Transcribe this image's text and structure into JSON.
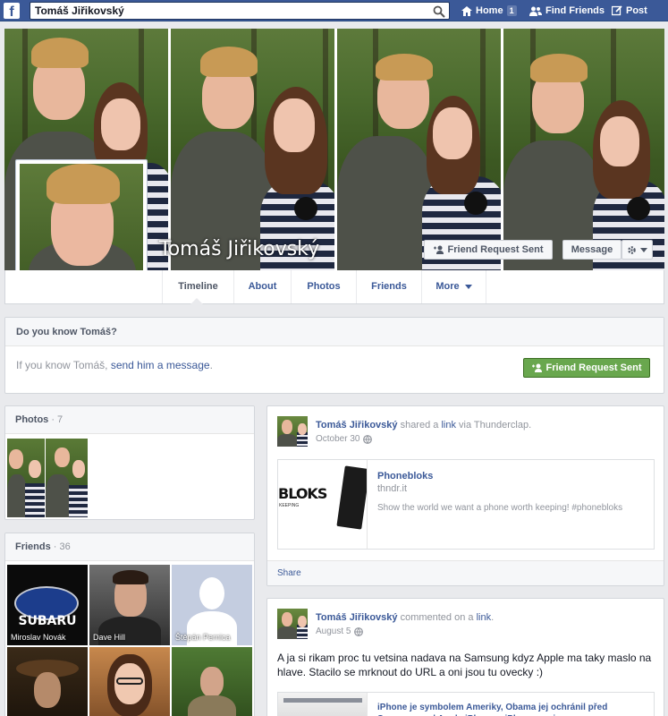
{
  "topbar": {
    "logo_icon": "facebook-f-icon",
    "search_value": "Tomáš Jiřikovský",
    "search_icon": "search-icon",
    "home_label": "Home",
    "home_badge": "1",
    "find_friends_label": "Find Friends",
    "post_label": "Post"
  },
  "profile": {
    "name": "Tomáš Jiřikovský",
    "friend_request_label": "Friend Request Sent",
    "message_label": "Message",
    "settings_icon": "gear-icon"
  },
  "tabs": [
    {
      "label": "Timeline"
    },
    {
      "label": "About"
    },
    {
      "label": "Photos"
    },
    {
      "label": "Friends"
    },
    {
      "label": "More"
    }
  ],
  "know": {
    "title": "Do you know Tomáš?",
    "message_prefix": "If you know Tomáš, ",
    "message_link": "send him a message",
    "message_suffix": ".",
    "button_label": "Friend Request Sent"
  },
  "photos_box": {
    "title": "Photos",
    "count": " · 7"
  },
  "friends_box": {
    "title": "Friends",
    "count": " · 36",
    "friends": [
      {
        "name": "Miroslav Novák"
      },
      {
        "name": "Dave Hill"
      },
      {
        "name": "Štěpán Pernica"
      }
    ],
    "subaru_logo_text": "SUBARU"
  },
  "posts": [
    {
      "author": "Tomáš Jiřikovský",
      "action_prefix": " shared a ",
      "action_link": "link",
      "action_suffix": " via Thunderclap.",
      "date": "October 30",
      "link_title": "Phonebloks",
      "link_domain": "thndr.it",
      "link_desc": "Show the world we want a phone worth keeping! #phonebloks",
      "link_image_text": "BLOKS",
      "link_image_subtext": "KEEPING",
      "share_label": "Share"
    },
    {
      "author": "Tomáš Jiřikovský",
      "action_prefix": " commented on a ",
      "action_link": "link",
      "action_suffix": ".",
      "date": "August 5",
      "body": "A ja si rikam proc tu vetsina nadava na Samsung kdyz Apple ma taky maslo na hlave. Stacilo se mrknout do URL a oni jsou tu ovecky :)",
      "link_title": "iPhone je symbolem Ameriky, Obama jej ochránil před Samsungem | Apple iPhone – iPhonemania.cz"
    }
  ],
  "colors": {
    "brand_blue": "#3b5998",
    "green_button": "#69a74e",
    "page_bg": "#e9eaed"
  }
}
